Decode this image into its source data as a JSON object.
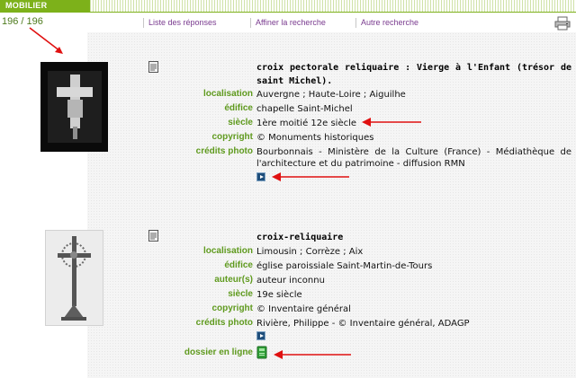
{
  "header": {
    "tab_label": "MOBILIER"
  },
  "counter": "196 / 196",
  "nav": {
    "list_label": "Liste des réponses",
    "refine_label": "Affiner la recherche",
    "other_label": "Autre recherche"
  },
  "labels": {
    "localisation": "localisation",
    "edifice": "édifice",
    "siecle": "siècle",
    "copyright": "copyright",
    "credits": "crédits photo",
    "auteur": "auteur(s)",
    "dossier": "dossier en ligne"
  },
  "records": [
    {
      "title": "croix pectorale reliquaire : Vierge à l'Enfant (trésor de saint Michel).",
      "localisation": "Auvergne ; Haute-Loire ; Aiguilhe",
      "edifice": "chapelle Saint-Michel",
      "siecle": "1ère moitié 12e siècle",
      "copyright": "© Monuments historiques",
      "credits": "Bourbonnais - Ministère de la Culture (France) - Médiathèque de l'architecture et du patrimoine - diffusion RMN"
    },
    {
      "title": "croix-reliquaire",
      "localisation": "Limousin ; Corrèze ; Aix",
      "edifice": "église paroissiale Saint-Martin-de-Tours",
      "auteur": "auteur inconnu",
      "siecle": "19e siècle",
      "copyright": "© Inventaire général",
      "credits": "Rivière, Philippe - © Inventaire général, ADAGP"
    }
  ],
  "icons": {
    "print": "printer-icon",
    "document": "document-icon",
    "play": "play-icon",
    "folder": "folder-icon",
    "annotation": "red-arrow"
  },
  "colors": {
    "brand_green": "#7db11a",
    "label_green": "#5f9a1e",
    "link_purple": "#7a3b8f",
    "annotation_red": "#e01010"
  }
}
